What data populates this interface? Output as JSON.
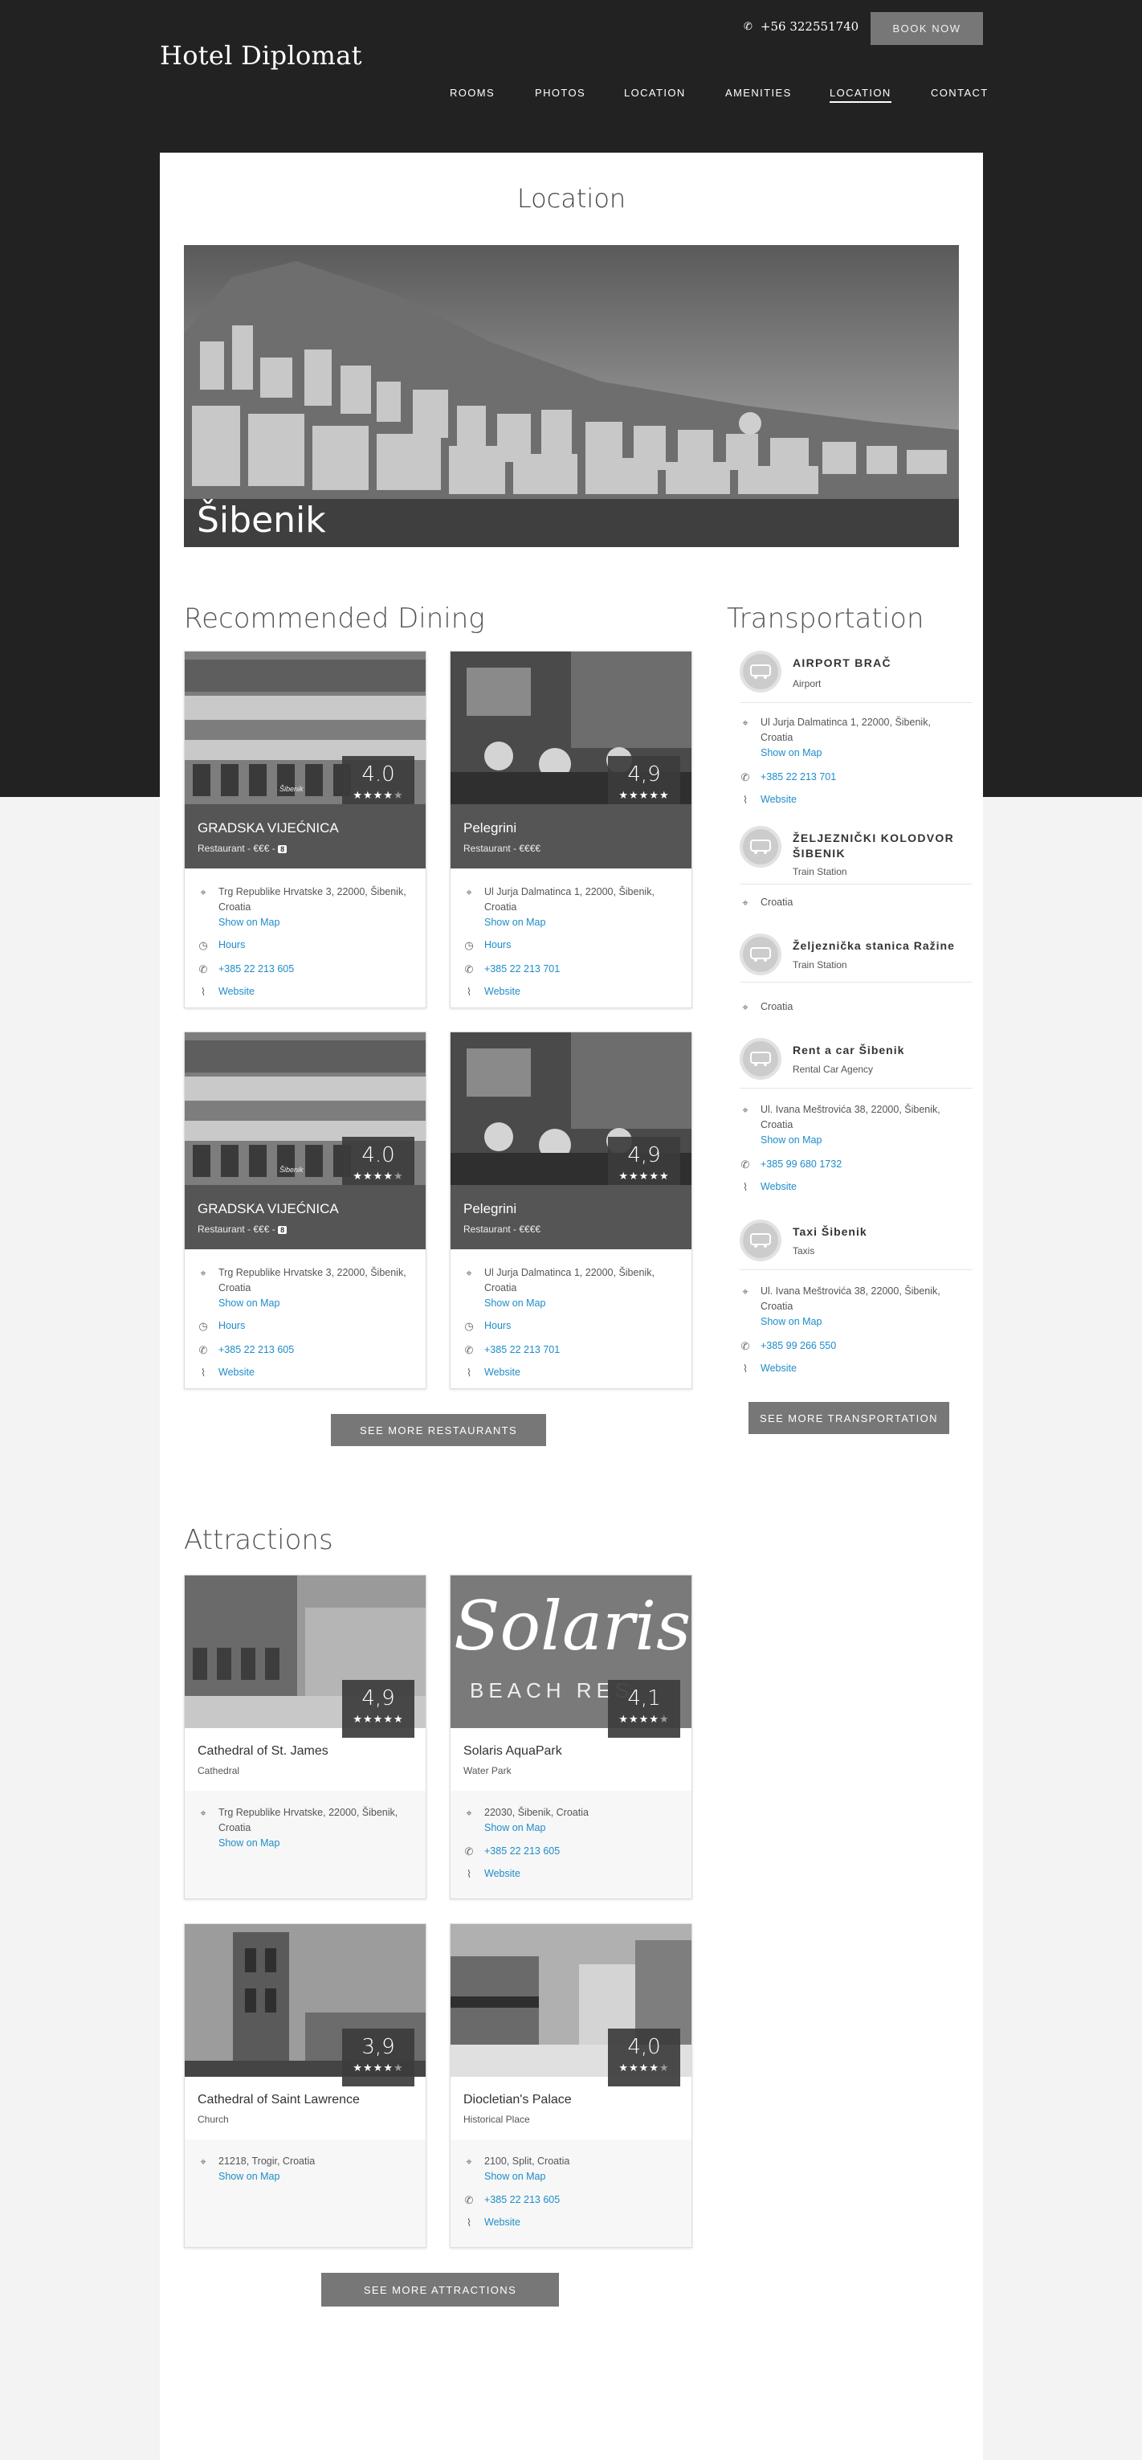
{
  "header": {
    "logo": "Hotel Diplomat",
    "phone": "+56 322551740",
    "book_now": "BOOK NOW",
    "nav": [
      "ROOMS",
      "PHOTOS",
      "LOCATION",
      "AMENITIES",
      "LOCATION",
      "CONTACT"
    ],
    "active_nav_index": 4
  },
  "page": {
    "title": "Location",
    "hero_caption": "Šibenik"
  },
  "dining": {
    "title": "Recommended Dining",
    "more_button": "SEE MORE RESTAURANTS",
    "watermark": "Šibenik",
    "cards": [
      {
        "name": "GRADSKA VIJEĆNICA",
        "sub": "Restaurant - €€€ -",
        "badge": "8",
        "rating": "4.0",
        "address": "Trg Republike Hrvatske 3, 22000, Šibenik, Croatia",
        "map": "Show on Map",
        "hours": "Hours",
        "phone": "+385 22 213 605",
        "website": "Website"
      },
      {
        "name": "Pelegrini",
        "sub": "Restaurant - €€€€",
        "badge": "",
        "rating": "4,9",
        "address": "Ul Jurja Dalmatinca 1, 22000, Šibenik, Croatia",
        "map": "Show on Map",
        "hours": "Hours",
        "phone": "+385 22 213 701",
        "website": "Website"
      },
      {
        "name": "GRADSKA VIJEĆNICA",
        "sub": "Restaurant - €€€ -",
        "badge": "8",
        "rating": "4.0",
        "address": "Trg Republike Hrvatske 3, 22000, Šibenik, Croatia",
        "map": "Show on Map",
        "hours": "Hours",
        "phone": "+385 22 213 605",
        "website": "Website"
      },
      {
        "name": "Pelegrini",
        "sub": "Restaurant - €€€€",
        "badge": "",
        "rating": "4,9",
        "address": "Ul Jurja Dalmatinca 1, 22000, Šibenik, Croatia",
        "map": "Show on Map",
        "hours": "Hours",
        "phone": "+385 22 213 701",
        "website": "Website"
      }
    ]
  },
  "transportation": {
    "title": "Transportation",
    "more_button": "SEE MORE TRANSPORTATION",
    "items": [
      {
        "name": "AIRPORT BRAČ",
        "type": "Airport",
        "address": "Ul Jurja Dalmatinca 1, 22000, Šibenik, Croatia",
        "map": "Show on Map",
        "phone": "+385 22 213 701",
        "website": "Website"
      },
      {
        "name": "ŽELJEZNIČKI KOLODVOR ŠIBENIK",
        "type": "Train Station",
        "address": "Croatia"
      },
      {
        "name": "Željeznička stanica Ražine",
        "type": "Train Station",
        "address": "Croatia"
      },
      {
        "name": "Rent a car Šibenik",
        "type": "Rental Car Agency",
        "address": "Ul. Ivana Meštrovića 38, 22000, Šibenik, Croatia",
        "map": "Show on Map",
        "phone": "+385 99 680 1732",
        "website": "Website"
      },
      {
        "name": "Taxi Šibenik",
        "type": "Taxis",
        "address": "Ul. Ivana Meštrovića 38, 22000, Šibenik, Croatia",
        "map": "Show on Map",
        "phone": "+385 99 266 550",
        "website": "Website"
      }
    ]
  },
  "attractions": {
    "title": "Attractions",
    "more_button": "SEE MORE ATTRACTIONS",
    "cards": [
      {
        "name": "Cathedral of St. James",
        "type": "Cathedral",
        "rating": "4,9",
        "address": "Trg Republike Hrvatske, 22000, Šibenik, Croatia",
        "map": "Show on Map"
      },
      {
        "name": "Solaris AquaPark",
        "type": "Water Park",
        "rating": "4,1",
        "address": "22030, Šibenik, Croatia",
        "map": "Show on Map",
        "phone": "+385 22 213 605",
        "website": "Website",
        "logo_text": "Solaris",
        "logo_sub": "BEACH RES"
      },
      {
        "name": "Cathedral of Saint Lawrence",
        "type": "Church",
        "rating": "3,9",
        "address": "21218, Trogir, Croatia",
        "map": "Show on Map"
      },
      {
        "name": "Diocletian's Palace",
        "type": "Historical Place",
        "rating": "4,0",
        "address": "2100, Split, Croatia",
        "map": "Show on Map",
        "phone": "+385 22 213 605",
        "website": "Website"
      }
    ]
  },
  "icons": {
    "phone": "phone-icon",
    "pin": "map-pin-icon",
    "clock": "clock-icon",
    "website": "paperclip-icon",
    "transport": "bus-icon"
  },
  "colors": {
    "header_bg": "#222222",
    "link": "#1e8cc8",
    "button": "#777777"
  }
}
